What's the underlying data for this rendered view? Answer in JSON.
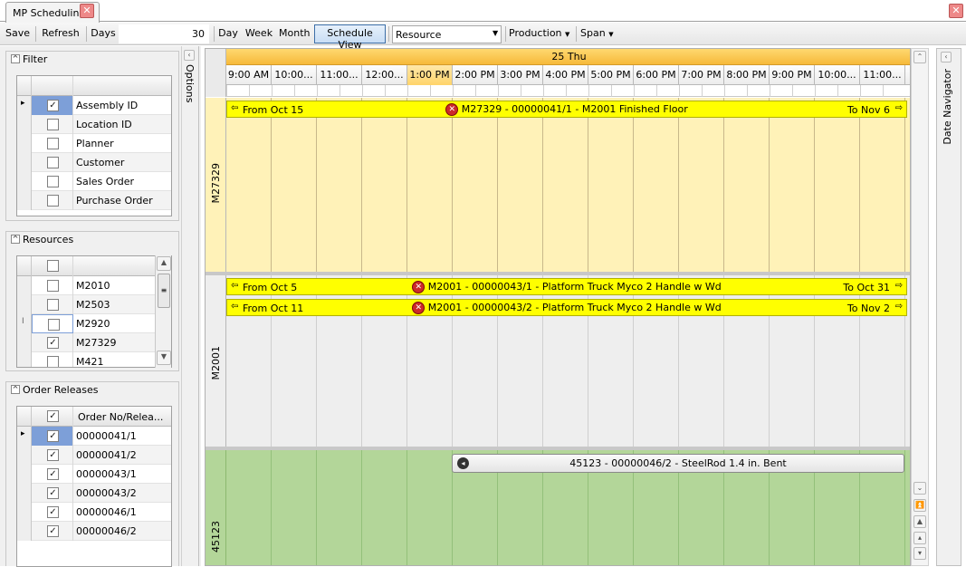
{
  "tab": {
    "title": "MP Scheduling"
  },
  "toolbar": {
    "save": "Save",
    "refresh": "Refresh",
    "days_label": "Days",
    "days_value": "30",
    "day": "Day",
    "week": "Week",
    "month": "Month",
    "schedule_view": "Schedule View",
    "group_by": "Resource",
    "production": "Production",
    "span": "Span"
  },
  "side_labels": {
    "options": "Options",
    "date_navigator": "Date Navigator"
  },
  "filter": {
    "title": "Filter",
    "items": [
      {
        "label": "Assembly ID",
        "checked": true
      },
      {
        "label": "Location ID",
        "checked": false
      },
      {
        "label": "Planner",
        "checked": false
      },
      {
        "label": "Customer",
        "checked": false
      },
      {
        "label": "Sales Order",
        "checked": false
      },
      {
        "label": "Purchase Order",
        "checked": false
      }
    ]
  },
  "resources": {
    "title": "Resources",
    "items": [
      {
        "label": "M2010",
        "checked": false
      },
      {
        "label": "M2503",
        "checked": false
      },
      {
        "label": "M2920",
        "checked": false
      },
      {
        "label": "M27329",
        "checked": true
      },
      {
        "label": "M421",
        "checked": false
      }
    ]
  },
  "order_releases": {
    "title": "Order Releases",
    "column": "Order No/Relea...",
    "items": [
      {
        "label": "00000041/1",
        "checked": true
      },
      {
        "label": "00000041/2",
        "checked": true
      },
      {
        "label": "00000043/1",
        "checked": true
      },
      {
        "label": "00000043/2",
        "checked": true
      },
      {
        "label": "00000046/1",
        "checked": true
      },
      {
        "label": "00000046/2",
        "checked": true
      }
    ]
  },
  "schedule": {
    "date_header": "25 Thu",
    "hours": [
      "9:00 AM",
      "10:00...",
      "11:00...",
      "12:00...",
      "1:00 PM",
      "2:00 PM",
      "3:00 PM",
      "4:00 PM",
      "5:00 PM",
      "6:00 PM",
      "7:00 PM",
      "8:00 PM",
      "9:00 PM",
      "10:00...",
      "11:00..."
    ],
    "current_hour_index": 4,
    "groups": [
      {
        "resource": "M27329",
        "color": "#fff2b8",
        "bars": [
          {
            "from": "From Oct 15",
            "text": "M27329 - 00000041/1 - M2001 Finished Floor",
            "to": "To Nov 6"
          }
        ]
      },
      {
        "resource": "M2001",
        "color": "#eeeeee",
        "bars": [
          {
            "from": "From Oct 5",
            "text": "M2001 - 00000043/1 - Platform Truck Myco 2 Handle w Wd",
            "to": "To Oct 31"
          },
          {
            "from": "From Oct 11",
            "text": "M2001 - 00000043/2 - Platform Truck Myco 2 Handle w Wd",
            "to": "To Nov 2"
          }
        ]
      },
      {
        "resource": "45123",
        "color": "#b3d699",
        "bars": [
          {
            "text": "45123 - 00000046/2 - SteelRod 1.4 in. Bent"
          }
        ]
      }
    ]
  }
}
